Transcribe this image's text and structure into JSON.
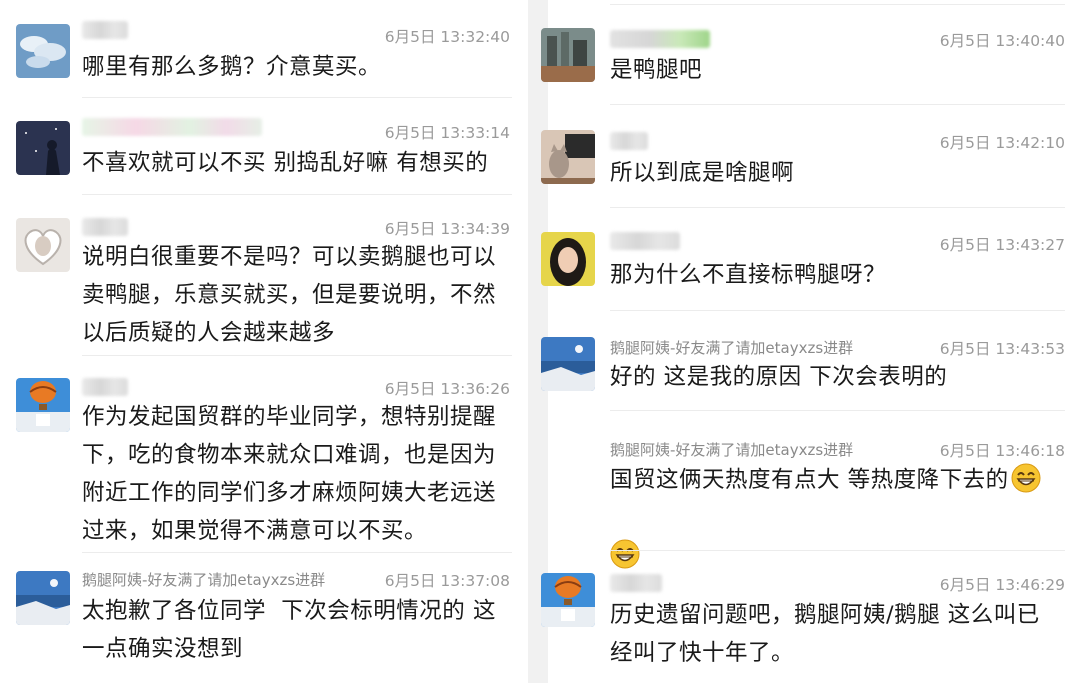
{
  "left_column": [
    {
      "name": "",
      "time": "6月5日 13:32:40",
      "text": "哪里有那么多鹅？介意莫买。",
      "avatar": "clouds-avatar"
    },
    {
      "name": "",
      "time": "6月5日 13:33:14",
      "text": "不喜欢就可以不买 别捣乱好嘛 有想买的",
      "avatar": "night-sky-avatar"
    },
    {
      "name": "",
      "time": "6月5日 13:34:39",
      "text": "说明白很重要不是吗？可以卖鹅腿也可以\n卖鸭腿，乐意买就买，但是要说明，不然\n以后质疑的人会越来越多",
      "avatar": "heart-frame-avatar"
    },
    {
      "name": "",
      "time": "6月5日 13:36:26",
      "text": "作为发起国贸群的毕业同学，想特别提醒\n下，吃的食物本来就众口难调，也是因为\n附近工作的同学们多才麻烦阿姨大老远送\n过来，如果觉得不满意可以不买。",
      "avatar": "hot-air-balloon-avatar"
    },
    {
      "name": "鹅腿阿姨-好友满了请加etayxzs进群",
      "time": "6月5日 13:37:08",
      "text": "太抱歉了各位同学  下次会标明情况的 这\n一点确实没想到",
      "avatar": "seaside-avatar"
    }
  ],
  "right_column": [
    {
      "name": "",
      "time": "6月5日 13:40:40",
      "text": "是鸭腿吧",
      "avatar": "city-avatar"
    },
    {
      "name": "",
      "time": "6月5日 13:42:10",
      "text": "所以到底是啥腿啊",
      "avatar": "cat-avatar"
    },
    {
      "name": "",
      "time": "6月5日 13:43:27",
      "text": "那为什么不直接标鸭腿呀？",
      "avatar": "portrait-avatar"
    },
    {
      "name": "鹅腿阿姨-好友满了请加etayxzs进群",
      "time": "6月5日 13:43:53",
      "text": "好的 这是我的原因 下次会表明的",
      "avatar": "seaside-avatar"
    },
    {
      "name": "鹅腿阿姨-好友满了请加etayxzs进群",
      "time": "6月5日 13:46:18",
      "text": "国贸这俩天热度有点大 等热度降下去的",
      "avatar": ""
    },
    {
      "name": "",
      "time": "6月5日 13:46:29",
      "text": "历史遗留问题吧，鹅腿阿姨/鹅腿 这么叫已\n经叫了快十年了。",
      "avatar": "hot-air-balloon-avatar"
    }
  ],
  "emoji": "grinning-face-icon"
}
